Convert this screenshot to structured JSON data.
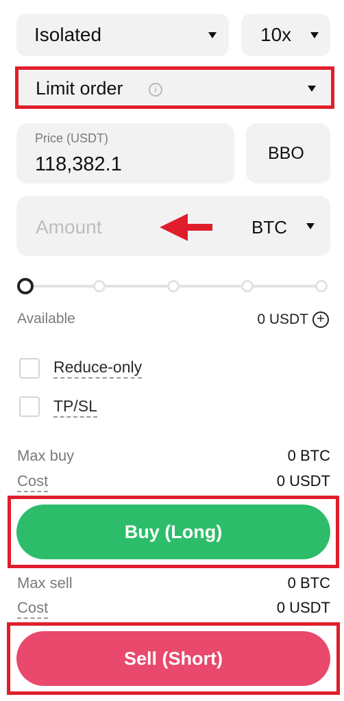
{
  "margin_mode": {
    "label": "Isolated"
  },
  "leverage": {
    "label": "10x"
  },
  "order_type": {
    "label": "Limit order",
    "info_icon": "info-icon"
  },
  "price": {
    "label": "Price (USDT)",
    "value": "118,382.1",
    "bbo_label": "BBO"
  },
  "amount": {
    "placeholder": "Amount",
    "unit": "BTC"
  },
  "slider": {
    "steps": 5,
    "value_fraction": 0
  },
  "available": {
    "label": "Available",
    "value": "0 USDT",
    "icon": "plus-circle-icon"
  },
  "options": {
    "reduce_only": "Reduce-only",
    "tpsl": "TP/SL"
  },
  "buy": {
    "max_label": "Max buy",
    "max_value": "0 BTC",
    "cost_label": "Cost",
    "cost_value": "0 USDT",
    "button_label": "Buy (Long)",
    "color": "#2dbd6a"
  },
  "sell": {
    "max_label": "Max sell",
    "max_value": "0 BTC",
    "cost_label": "Cost",
    "cost_value": "0 USDT",
    "button_label": "Sell (Short)",
    "color": "#e9496c"
  },
  "colors": {
    "highlight_frame": "#e01e2b",
    "arrow": "#e01e2b"
  }
}
